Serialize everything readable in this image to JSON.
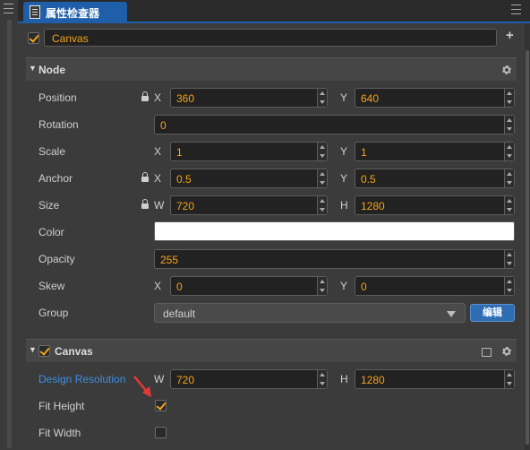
{
  "tab": {
    "title": "属性检查器"
  },
  "node": {
    "name": "Canvas",
    "active": true
  },
  "node_section": {
    "title": "Node",
    "position": {
      "label": "Position",
      "x_axis": "X",
      "x": "360",
      "y_axis": "Y",
      "y": "640"
    },
    "rotation": {
      "label": "Rotation",
      "value": "0"
    },
    "scale": {
      "label": "Scale",
      "x_axis": "X",
      "x": "1",
      "y_axis": "Y",
      "y": "1"
    },
    "anchor": {
      "label": "Anchor",
      "x_axis": "X",
      "x": "0.5",
      "y_axis": "Y",
      "y": "0.5"
    },
    "size": {
      "label": "Size",
      "w_axis": "W",
      "w": "720",
      "h_axis": "H",
      "h": "1280"
    },
    "color": {
      "label": "Color",
      "value": "#ffffff"
    },
    "opacity": {
      "label": "Opacity",
      "value": "255"
    },
    "skew": {
      "label": "Skew",
      "x_axis": "X",
      "x": "0",
      "y_axis": "Y",
      "y": "0"
    },
    "group": {
      "label": "Group",
      "value": "default",
      "edit_label": "编辑"
    }
  },
  "canvas_section": {
    "title": "Canvas",
    "enabled": true,
    "design_resolution": {
      "label": "Design Resolution",
      "w_axis": "W",
      "w": "720",
      "h_axis": "H",
      "h": "1280"
    },
    "fit_height": {
      "label": "Fit Height",
      "checked": true
    },
    "fit_width": {
      "label": "Fit Width",
      "checked": false
    }
  },
  "colors": {
    "accent": "#f5a219",
    "tab": "#1f5ea8",
    "link": "#3d8fe6",
    "arrow": "#e53935"
  }
}
